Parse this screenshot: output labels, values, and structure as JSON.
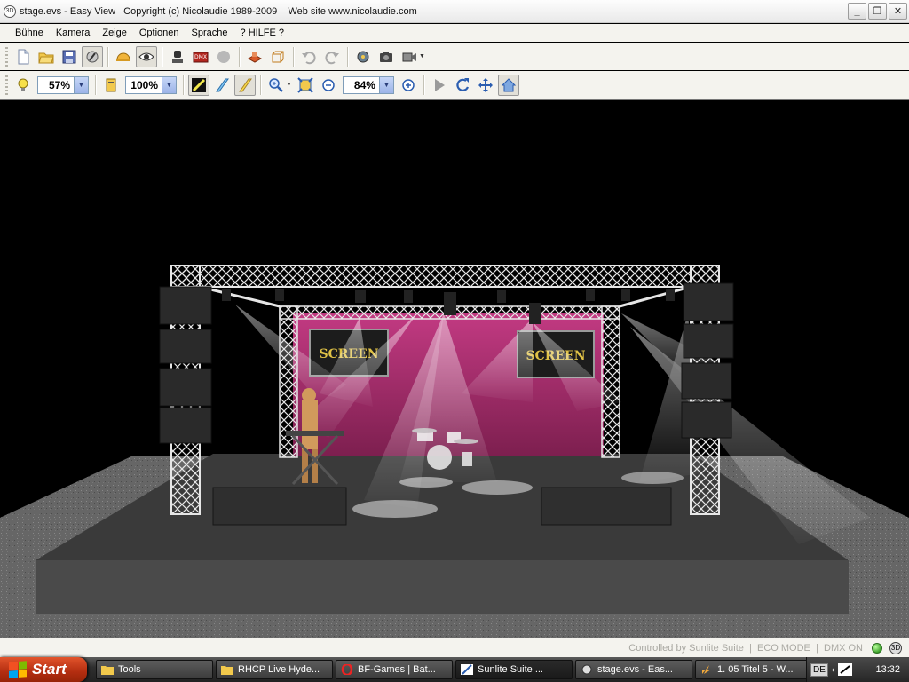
{
  "window": {
    "title": "stage.evs - Easy View   Copyright (c) Nicolaudie 1989-2009    Web site www.nicolaudie.com",
    "minimize": "_",
    "maximize": "❐",
    "close": "✕"
  },
  "menu": {
    "items": [
      "Bühne",
      "Kamera",
      "Zeige",
      "Optionen",
      "Sprache",
      "? HILFE ?"
    ]
  },
  "toolbar2": {
    "light_zoom": "57%",
    "opacity": "100%",
    "view_zoom": "84%"
  },
  "viewport": {
    "screen_left_label": "SCREEN",
    "screen_right_label": "SCREEN"
  },
  "statusbar": {
    "controlled_by": "Controlled by Sunlite Suite",
    "eco_mode": "ECO MODE",
    "dmx": "DMX ON",
    "led_color": "#3ca22a"
  },
  "taskbar": {
    "start_label": "Start",
    "tasks": [
      {
        "label": "Tools",
        "icon": "folder-icon"
      },
      {
        "label": "RHCP Live Hyde...",
        "icon": "folder-icon"
      },
      {
        "label": "BF-Games | Bat...",
        "icon": "opera-icon"
      },
      {
        "label": "Sunlite Suite     ...",
        "icon": "sunlite-icon"
      },
      {
        "label": "stage.evs - Eas...",
        "icon": "easyview-icon"
      },
      {
        "label": "1. 05 Titel 5 - W...",
        "icon": "winamp-icon"
      }
    ],
    "lang": "DE",
    "clock": "13:32"
  }
}
